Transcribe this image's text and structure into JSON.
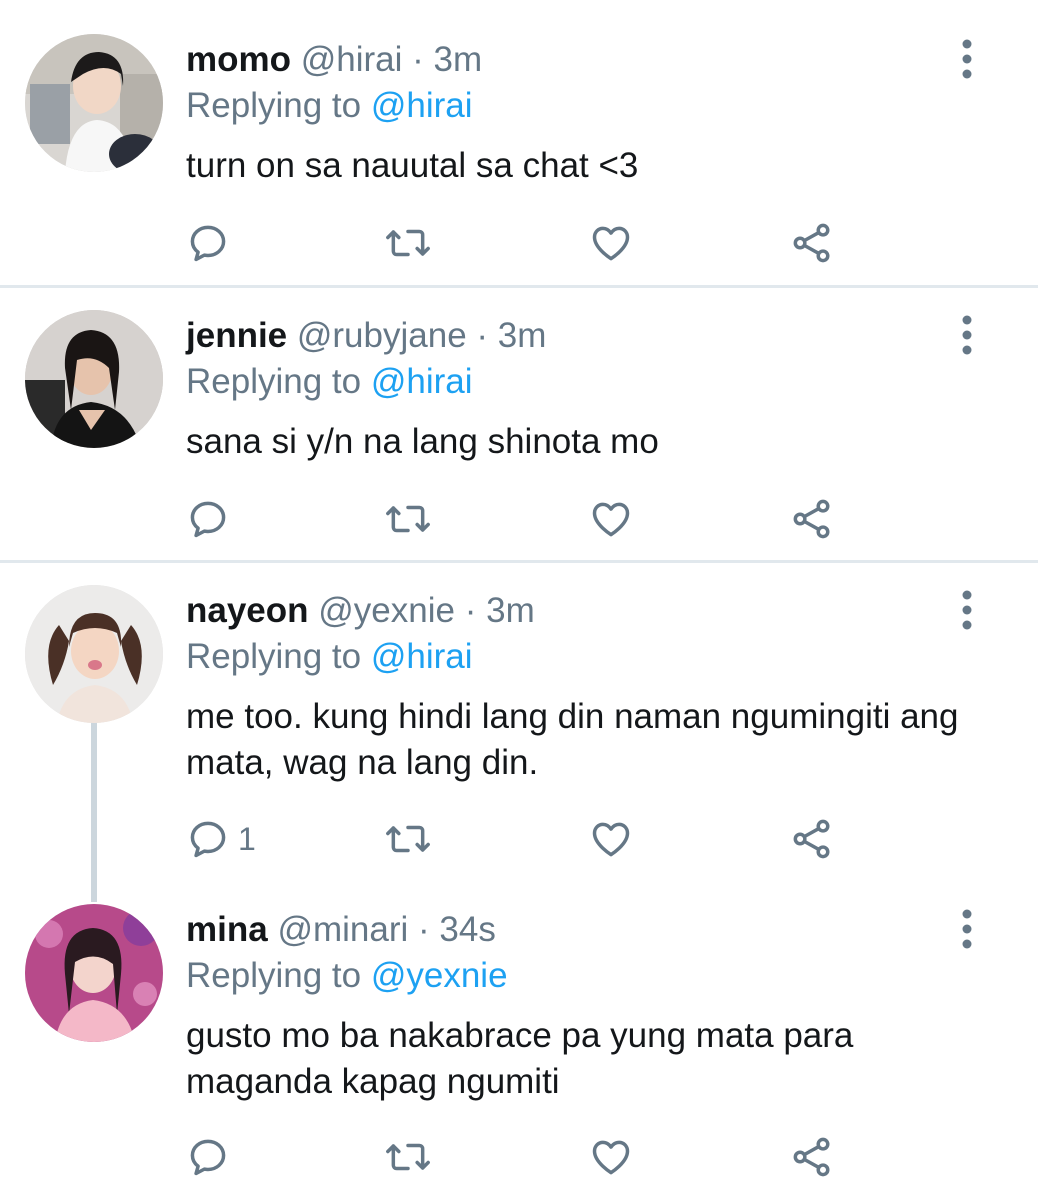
{
  "tweets": [
    {
      "name": "momo",
      "handle": "@hirai",
      "separator": "·",
      "time": "3m",
      "replying_prefix": "Replying to",
      "replying_to": "@hirai",
      "text": "turn on sa nauutal sa chat <3",
      "reply_count": ""
    },
    {
      "name": "jennie",
      "handle": "@rubyjane",
      "separator": "·",
      "time": "3m",
      "replying_prefix": "Replying to",
      "replying_to": "@hirai",
      "text": "sana si y/n na lang shinota mo",
      "reply_count": ""
    },
    {
      "name": "nayeon",
      "handle": "@yexnie",
      "separator": "·",
      "time": "3m",
      "replying_prefix": "Replying to",
      "replying_to": "@hirai",
      "text": "me too. kung hindi lang din naman ngumingiti ang mata, wag na lang din.",
      "reply_count": "1"
    },
    {
      "name": "mina",
      "handle": "@minari",
      "separator": "·",
      "time": "34s",
      "replying_prefix": "Replying to",
      "replying_to": "@yexnie",
      "text": "gusto mo ba nakabrace pa yung mata para maganda kapag ngumiti",
      "reply_count": ""
    }
  ],
  "icons": {
    "reply": "reply-icon",
    "retweet": "retweet-icon",
    "like": "heart-icon",
    "share": "share-icon",
    "more": "more-vertical-icon"
  },
  "colors": {
    "text": "#14171a",
    "secondary": "#657786",
    "link": "#1da1f2",
    "divider": "#e1e8ed",
    "thread_line": "#ccd6dd"
  }
}
